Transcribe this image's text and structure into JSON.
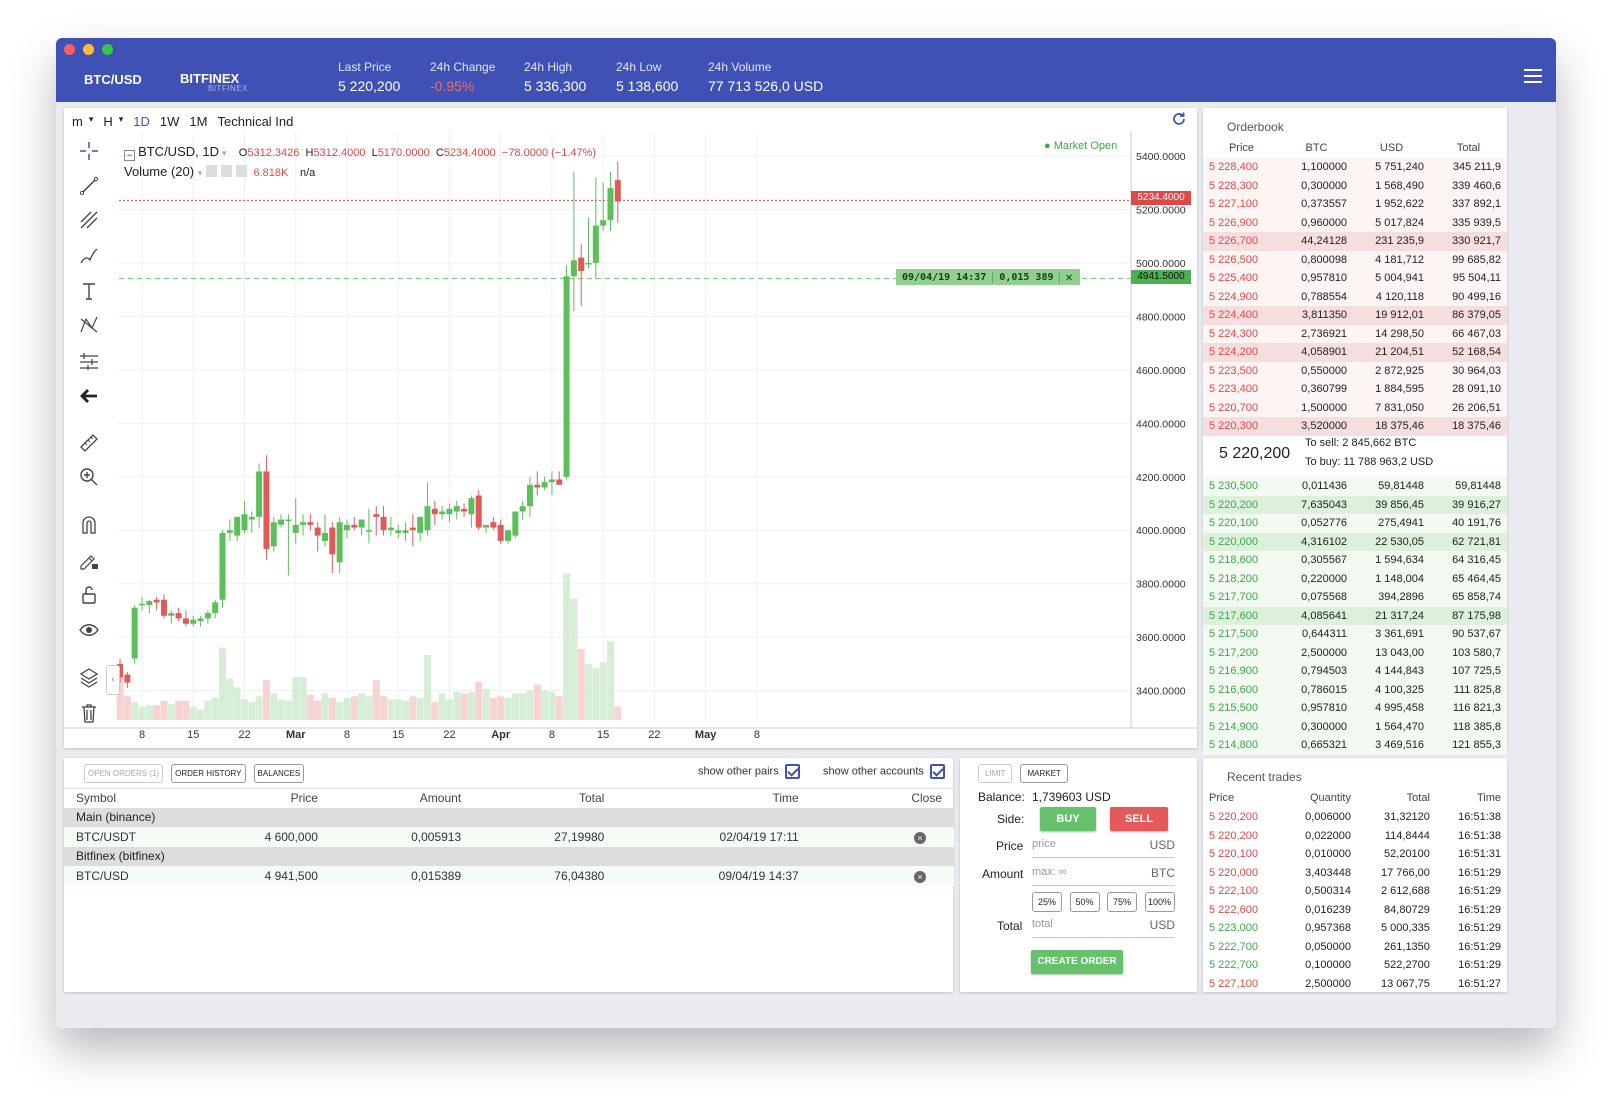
{
  "header": {
    "pair": "BTC/USD",
    "exchange": "BITFINEX",
    "exchange_sub": "BITFINEX",
    "stats": [
      {
        "label": "Last Price",
        "value": "5 220,200",
        "neg": false
      },
      {
        "label": "24h Change",
        "value": "-0.95%",
        "neg": true
      },
      {
        "label": "24h High",
        "value": "5 336,300",
        "neg": false
      },
      {
        "label": "24h Low",
        "value": "5 138,600",
        "neg": false
      },
      {
        "label": "24h Volume",
        "value": "77 713 526,0 USD",
        "neg": false
      }
    ]
  },
  "chart_toolbar": {
    "items": [
      "m",
      "H",
      "1D",
      "1W",
      "1M",
      "Technical Ind"
    ],
    "selected": "1D"
  },
  "chart_legend": {
    "symbol": "BTC/USD, 1D",
    "o_label": "O",
    "o": "5312.3426",
    "h_label": "H",
    "h": "5312.4000",
    "l_label": "L",
    "l": "5170.0000",
    "c_label": "C",
    "c": "5234.4000",
    "change": "−78.0000 (−1.47%)",
    "volume_label": "Volume (20)",
    "volume": "6.818K",
    "volume_extra": "n/a",
    "market_status": "Market Open"
  },
  "chart_overlay": {
    "current_price": "5234.4000",
    "order_price": "4941.5000",
    "order_date": "09/04/19 14:37",
    "order_amount": "0,015 389"
  },
  "chart_data": {
    "type": "candlestick",
    "title": "BTC/USD, 1D",
    "yticks": [
      "5400.0000",
      "5200.0000",
      "5000.0000",
      "4800.0000",
      "4600.0000",
      "4400.0000",
      "4200.0000",
      "4000.0000",
      "3800.0000",
      "3600.0000",
      "3400.0000"
    ],
    "ylim": [
      3290,
      5490
    ],
    "xticks": [
      "8",
      "15",
      "22",
      "Mar",
      "8",
      "15",
      "22",
      "Apr",
      "8",
      "15",
      "22",
      "May",
      "8"
    ],
    "candles": [
      [
        3500,
        3520,
        3430,
        3450,
        3.0
      ],
      [
        3460,
        3470,
        3410,
        3430,
        1.6
      ],
      [
        3520,
        3720,
        3500,
        3710,
        1.2
      ],
      [
        3720,
        3750,
        3700,
        3725,
        0.9
      ],
      [
        3720,
        3740,
        3690,
        3735,
        1.0
      ],
      [
        3740,
        3750,
        3700,
        3730,
        1.0
      ],
      [
        3740,
        3760,
        3670,
        3680,
        1.3
      ],
      [
        3680,
        3700,
        3650,
        3690,
        1.1
      ],
      [
        3690,
        3710,
        3660,
        3670,
        1.3
      ],
      [
        3670,
        3700,
        3640,
        3650,
        1.3
      ],
      [
        3650,
        3680,
        3640,
        3665,
        0.9
      ],
      [
        3660,
        3680,
        3640,
        3670,
        0.7
      ],
      [
        3670,
        3700,
        3650,
        3690,
        1.3
      ],
      [
        3690,
        3740,
        3670,
        3730,
        1.5
      ],
      [
        3740,
        4000,
        3710,
        3990,
        4.9
      ],
      [
        3990,
        4040,
        3960,
        4000,
        2.8
      ],
      [
        3980,
        4050,
        3960,
        4050,
        2.2
      ],
      [
        4000,
        4110,
        3990,
        4060,
        1.4
      ],
      [
        4040,
        4070,
        3990,
        4050,
        1.2
      ],
      [
        4050,
        4250,
        4010,
        4220,
        1.6
      ],
      [
        4220,
        4280,
        3890,
        3930,
        2.7
      ],
      [
        3940,
        4050,
        3920,
        4030,
        1.8
      ],
      [
        4020,
        4060,
        4010,
        4040,
        1.4
      ],
      [
        4040,
        4060,
        3830,
        4040,
        1.3
      ],
      [
        3990,
        4120,
        3950,
        4020,
        2.9
      ],
      [
        4020,
        4060,
        3980,
        4030,
        2.9
      ],
      [
        4030,
        4060,
        4000,
        4020,
        1.7
      ],
      [
        4010,
        4030,
        3920,
        3980,
        1.3
      ],
      [
        3960,
        4060,
        3940,
        3990,
        1.8
      ],
      [
        4010,
        4030,
        3840,
        3910,
        1.5
      ],
      [
        3880,
        4050,
        3840,
        4030,
        1.2
      ],
      [
        4000,
        4040,
        3970,
        4020,
        1.5
      ],
      [
        4020,
        4050,
        4000,
        4010,
        1.6
      ],
      [
        4010,
        4040,
        3980,
        4040,
        1.8
      ],
      [
        4000,
        4080,
        3950,
        4000,
        1.6
      ],
      [
        4060,
        4090,
        3980,
        4050,
        2.7
      ],
      [
        4050,
        4090,
        3980,
        4000,
        1.6
      ],
      [
        4000,
        4050,
        3980,
        4010,
        1.4
      ],
      [
        3990,
        4020,
        3970,
        4000,
        1.4
      ],
      [
        3990,
        4030,
        3960,
        4000,
        1.3
      ],
      [
        4010,
        4060,
        3940,
        4000,
        1.6
      ],
      [
        3990,
        4050,
        3960,
        4050,
        1.5
      ],
      [
        4000,
        4180,
        3980,
        4090,
        4.4
      ],
      [
        4080,
        4110,
        4020,
        4060,
        1.2
      ],
      [
        4060,
        4090,
        4040,
        4070,
        1.8
      ],
      [
        4060,
        4100,
        4030,
        4080,
        1.4
      ],
      [
        4070,
        4110,
        4040,
        4090,
        1.9
      ],
      [
        4080,
        4100,
        4050,
        4070,
        1.8
      ],
      [
        4060,
        4130,
        4010,
        4120,
        1.9
      ],
      [
        4130,
        4150,
        4000,
        4010,
        2.6
      ],
      [
        4010,
        4020,
        3990,
        4020,
        2.1
      ],
      [
        4030,
        4050,
        4000,
        4010,
        1.5
      ],
      [
        4020,
        4040,
        3950,
        3960,
        1.6
      ],
      [
        3960,
        4000,
        3950,
        4000,
        1.5
      ],
      [
        3980,
        4070,
        3970,
        4070,
        1.8
      ],
      [
        4070,
        4110,
        4040,
        4090,
        1.8
      ],
      [
        4090,
        4200,
        4050,
        4170,
        2.0
      ],
      [
        4170,
        4220,
        4130,
        4160,
        2.4
      ],
      [
        4160,
        4200,
        4150,
        4180,
        2.0
      ],
      [
        4180,
        4220,
        4130,
        4190,
        1.9
      ],
      [
        4190,
        4220,
        4170,
        4170,
        1.6
      ],
      [
        4200,
        4990,
        4190,
        4950,
        9.9
      ],
      [
        4950,
        5340,
        4820,
        5010,
        8.2
      ],
      [
        5020,
        5070,
        4840,
        4970,
        4.8
      ],
      [
        5000,
        5170,
        4980,
        5000,
        3.8
      ],
      [
        5000,
        5320,
        4940,
        5140,
        3.5
      ],
      [
        5140,
        5300,
        5120,
        5160,
        3.9
      ],
      [
        5160,
        5340,
        5120,
        5280,
        5.3
      ],
      [
        5310,
        5380,
        5150,
        5230,
        0.9
      ]
    ]
  },
  "orderbook": {
    "title": "Orderbook",
    "cols": [
      "Price",
      "BTC",
      "USD",
      "Total"
    ],
    "asks": [
      [
        "5 228,400",
        "1,100000",
        "5 751,240",
        "345 211,9",
        0
      ],
      [
        "5 228,300",
        "0,300000",
        "1 568,490",
        "339 460,6",
        0
      ],
      [
        "5 227,100",
        "0,373557",
        "1 952,622",
        "337 892,1",
        0
      ],
      [
        "5 226,900",
        "0,960000",
        "5 017,824",
        "335 939,5",
        0
      ],
      [
        "5 226,700",
        "44,24128",
        "231 235,9",
        "330 921,7",
        1
      ],
      [
        "5 226,500",
        "0,800098",
        "4 181,712",
        "99 685,82",
        0
      ],
      [
        "5 225,400",
        "0,957810",
        "5 004,941",
        "95 504,11",
        0
      ],
      [
        "5 224,900",
        "0,788554",
        "4 120,118",
        "90 499,16",
        0
      ],
      [
        "5 224,400",
        "3,811350",
        "19 912,01",
        "86 379,05",
        1
      ],
      [
        "5 224,300",
        "2,736921",
        "14 298,50",
        "66 467,03",
        0
      ],
      [
        "5 224,200",
        "4,058901",
        "21 204,51",
        "52 168,54",
        1
      ],
      [
        "5 223,500",
        "0,550000",
        "2 872,925",
        "30 964,03",
        0
      ],
      [
        "5 223,400",
        "0,360799",
        "1 884,595",
        "28 091,10",
        0
      ],
      [
        "5 220,700",
        "1,500000",
        "7 831,050",
        "26 206,51",
        0
      ],
      [
        "5 220,300",
        "3,520000",
        "18 375,46",
        "18 375,46",
        1
      ]
    ],
    "mid_price": "5 220,200",
    "to_sell": "To sell: 2 845,662 BTC",
    "to_buy": "To buy: 11 788 963,2 USD",
    "bids": [
      [
        "5 230,500",
        "0,011436",
        "59,81448",
        "59,81448",
        0
      ],
      [
        "5 220,200",
        "7,635043",
        "39 856,45",
        "39 916,27",
        1
      ],
      [
        "5 220,100",
        "0,052776",
        "275,4941",
        "40 191,76",
        0
      ],
      [
        "5 220,000",
        "4,316102",
        "22 530,05",
        "62 721,81",
        1
      ],
      [
        "5 218,600",
        "0,305567",
        "1 594,634",
        "64 316,45",
        0
      ],
      [
        "5 218,200",
        "0,220000",
        "1 148,004",
        "65 464,45",
        0
      ],
      [
        "5 217,700",
        "0,075568",
        "394,2896",
        "65 858,74",
        0
      ],
      [
        "5 217,600",
        "4,085641",
        "21 317,24",
        "87 175,98",
        1
      ],
      [
        "5 217,500",
        "0,644311",
        "3 361,691",
        "90 537,67",
        0
      ],
      [
        "5 217,200",
        "2,500000",
        "13 043,00",
        "103 580,7",
        0
      ],
      [
        "5 216,900",
        "0,794503",
        "4 144,843",
        "107 725,5",
        0
      ],
      [
        "5 216,600",
        "0,786015",
        "4 100,325",
        "111 825,8",
        0
      ],
      [
        "5 215,500",
        "0,957810",
        "4 995,458",
        "116 821,3",
        0
      ],
      [
        "5 214,900",
        "0,300000",
        "1 564,470",
        "118 385,8",
        0
      ],
      [
        "5 214,800",
        "0,665321",
        "3 469,516",
        "121 855,3",
        0
      ]
    ]
  },
  "orders": {
    "tabs": [
      "OPEN ORDERS (1)",
      "ORDER HISTORY",
      "BALANCES"
    ],
    "show_pairs": "show other pairs",
    "show_accounts": "show other accounts",
    "cols": [
      "Symbol",
      "Price",
      "Amount",
      "Total",
      "Time",
      "Close"
    ],
    "groups": [
      {
        "name": "Main (binance)",
        "rows": [
          [
            "BTC/USDT",
            "4 600,000",
            "0,005913",
            "27,19980",
            "02/04/19 17:11"
          ]
        ]
      },
      {
        "name": "Bitfinex (bitfinex)",
        "rows": [
          [
            "BTC/USD",
            "4 941,500",
            "0,015389",
            "76,04380",
            "09/04/19 14:37"
          ]
        ]
      }
    ]
  },
  "trade_form": {
    "tabs": [
      "LIMIT",
      "MARKET"
    ],
    "balance_label": "Balance:",
    "balance": "1,739603 USD",
    "side_label": "Side:",
    "buy": "BUY",
    "sell": "SELL",
    "price_label": "Price",
    "price_ph": "price",
    "price_unit": "USD",
    "amount_label": "Amount",
    "amount_ph": "max: ∞",
    "amount_unit": "BTC",
    "pcts": [
      "25%",
      "50%",
      "75%",
      "100%"
    ],
    "total_label": "Total",
    "total_ph": "total",
    "total_unit": "USD",
    "create": "CREATE ORDER"
  },
  "recent_trades": {
    "title": "Recent trades",
    "cols": [
      "Price",
      "Quantity",
      "Total",
      "Time"
    ],
    "rows": [
      [
        "5 220,200",
        "0,006000",
        "31,32120",
        "16:51:38",
        "s"
      ],
      [
        "5 220,200",
        "0,022000",
        "114,8444",
        "16:51:38",
        "s"
      ],
      [
        "5 220,100",
        "0,010000",
        "52,20100",
        "16:51:31",
        "s"
      ],
      [
        "5 220,000",
        "3,403448",
        "17 766,00",
        "16:51:29",
        "s"
      ],
      [
        "5 222,100",
        "0,500314",
        "2 612,688",
        "16:51:29",
        "s"
      ],
      [
        "5 222,600",
        "0,016239",
        "84,80729",
        "16:51:29",
        "s"
      ],
      [
        "5 223,000",
        "0,957368",
        "5 000,335",
        "16:51:29",
        "b"
      ],
      [
        "5 222,700",
        "0,050000",
        "261,1350",
        "16:51:29",
        "b"
      ],
      [
        "5 222,700",
        "0,100000",
        "522,2700",
        "16:51:29",
        "b"
      ],
      [
        "5 227,100",
        "2,500000",
        "13 067,75",
        "16:51:27",
        "s"
      ]
    ]
  },
  "colors": {
    "accent": "#3f51b5",
    "up": "#4caf50",
    "down": "#e04848"
  }
}
